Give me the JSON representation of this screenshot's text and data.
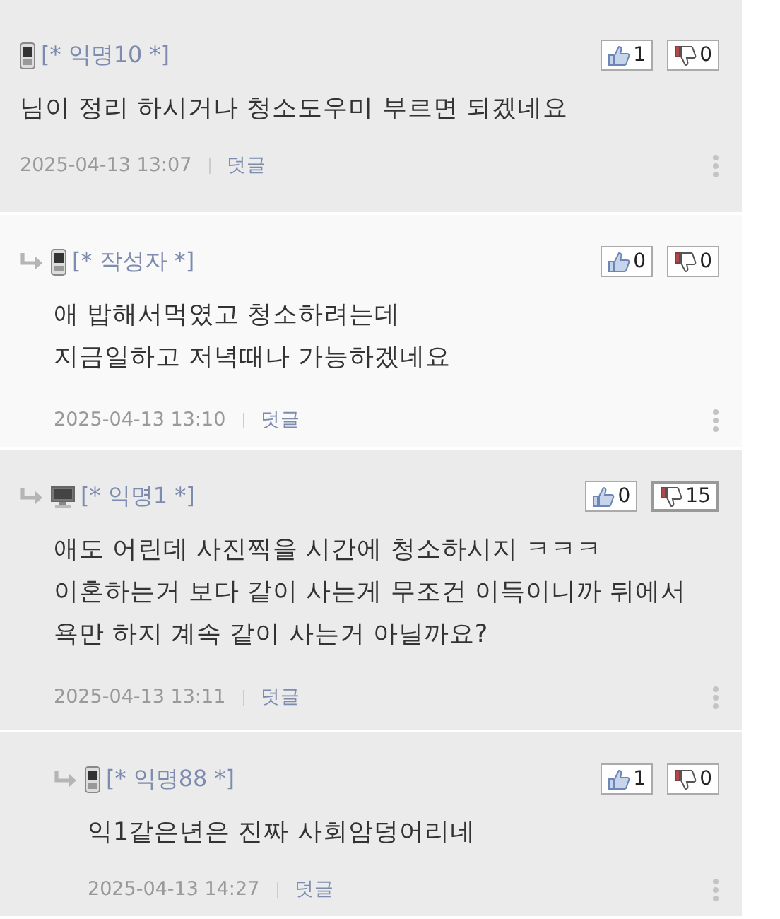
{
  "comments": [
    {
      "author": "[* 익명10 *]",
      "kind": "phone",
      "highlighted": false,
      "likes": "1",
      "dislikes": "0",
      "dislikes_hot": false,
      "body": [
        "님이 정리 하시거나 청소도우미 부르면 되겠네요"
      ],
      "date": "2025-04-13 13:07",
      "reply_label": "덧글",
      "children": [
        {
          "author": "[* 작성자 *]",
          "kind": "phone",
          "highlighted": true,
          "likes": "0",
          "dislikes": "0",
          "dislikes_hot": false,
          "body": [
            "애 밥해서먹였고 청소하려는데",
            "지금일하고 저녁때나 가능하겠네요"
          ],
          "date": "2025-04-13 13:10",
          "reply_label": "덧글"
        },
        {
          "author": "[* 익명1 *]",
          "kind": "pc",
          "highlighted": false,
          "likes": "0",
          "dislikes": "15",
          "dislikes_hot": true,
          "body": [
            "애도 어린데 사진찍을 시간에 청소하시지 ㅋㅋㅋ",
            "이혼하는거 보다 같이 사는게 무조건 이득이니까 뒤에서",
            "욕만 하지 계속 같이 사는거 아닐까요?"
          ],
          "date": "2025-04-13 13:11",
          "reply_label": "덧글",
          "children": [
            {
              "author": "[* 익명88 *]",
              "kind": "phone",
              "highlighted": false,
              "likes": "1",
              "dislikes": "0",
              "dislikes_hot": false,
              "body": [
                "익1같은년은 진짜 사회암덩어리네"
              ],
              "date": "2025-04-13 14:27",
              "reply_label": "덧글"
            }
          ]
        }
      ]
    }
  ]
}
